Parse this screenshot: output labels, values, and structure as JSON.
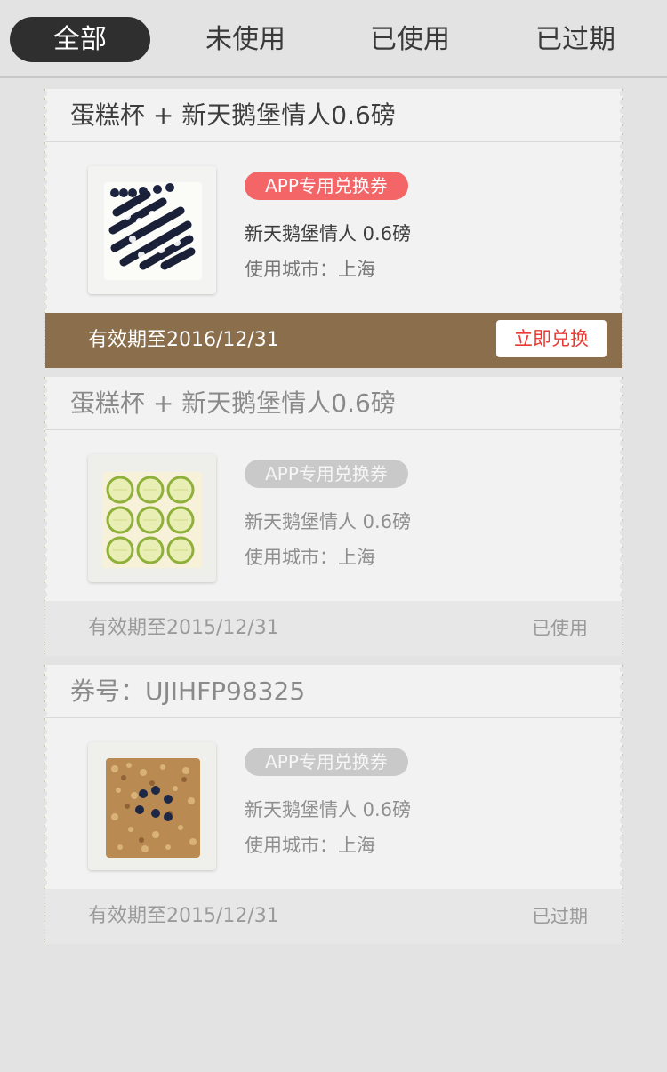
{
  "tabs": [
    {
      "label": "全部",
      "active": true
    },
    {
      "label": "未使用",
      "active": false
    },
    {
      "label": "已使用",
      "active": false
    },
    {
      "label": "已过期",
      "active": false
    }
  ],
  "coupons": [
    {
      "title": "蛋糕杯 + 新天鹅堡情人0.6磅",
      "badge": "APP专用兑换券",
      "product": "新天鹅堡情人   0.6磅",
      "city": "使用城市：上海",
      "expiry": "有效期至2016/12/31",
      "action_label": "立即兑换",
      "image": "blueberry-cake-icon"
    },
    {
      "title": "蛋糕杯 + 新天鹅堡情人0.6磅",
      "badge": "APP专用兑换券",
      "product": "新天鹅堡情人   0.6磅",
      "city": "使用城市：上海",
      "expiry": "有效期至2015/12/31",
      "status": "已使用",
      "image": "lime-cake-icon"
    },
    {
      "title": "券号：UJIHFP98325",
      "badge": "APP专用兑换券",
      "product": "新天鹅堡情人   0.6磅",
      "city": "使用城市：上海",
      "expiry": "有效期至2015/12/31",
      "status": "已过期",
      "image": "nut-cake-icon"
    }
  ],
  "colors": {
    "active_tab_bg": "#2f2f2f",
    "badge_red": "#f36567",
    "footer_brown": "#8b6f4c",
    "redeem_text": "#e83b35"
  }
}
